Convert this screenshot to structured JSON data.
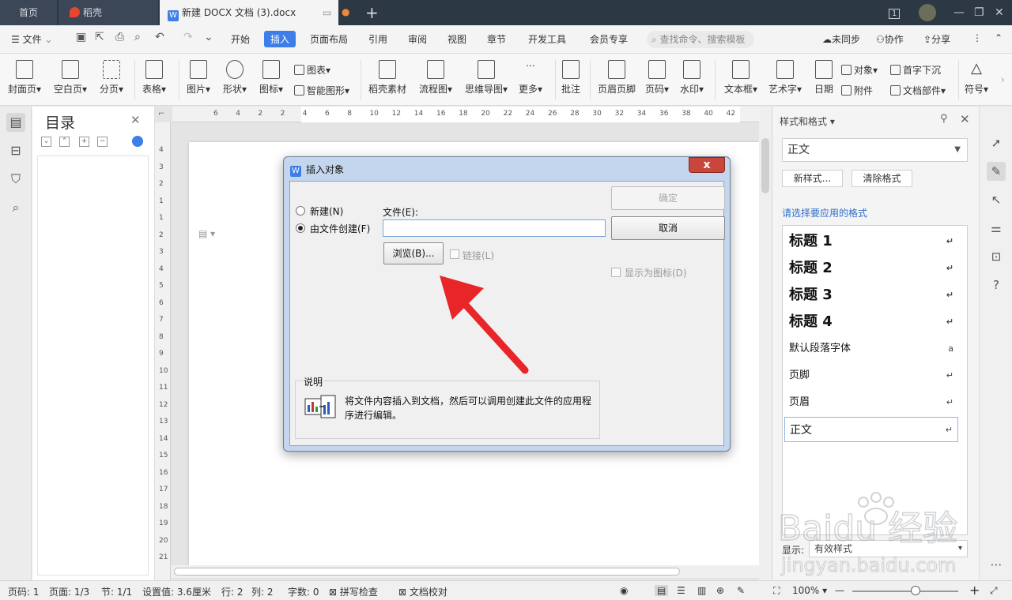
{
  "titlebar": {
    "tabs": [
      {
        "label": "首页"
      },
      {
        "label": "稻壳"
      },
      {
        "label": "新建 DOCX 文档 (3).docx"
      }
    ],
    "new_tab": "+",
    "page_badge": "1"
  },
  "menubar": {
    "file": "文件",
    "items": [
      "开始",
      "插入",
      "页面布局",
      "引用",
      "审阅",
      "视图",
      "章节",
      "开发工具",
      "会员专享"
    ],
    "search_placeholder": "查找命令、搜索模板",
    "sync": "未同步",
    "collab": "协作",
    "share": "分享"
  },
  "ribbon": {
    "cover": "封面页",
    "blank": "空白页",
    "pagebreak": "分页",
    "table": "表格",
    "picture": "图片",
    "shape": "形状",
    "icon": "图标",
    "chart": "图表",
    "smartart": "智能图形",
    "daoke": "稻壳素材",
    "flowchart": "流程图",
    "mindmap": "思维导图",
    "more": "更多",
    "comment": "批注",
    "header_footer": "页眉页脚",
    "page_number": "页码",
    "watermark": "水印",
    "textbox": "文本框",
    "wordart": "艺术字",
    "date": "日期",
    "object": "对象",
    "attachment": "附件",
    "dropcap": "首字下沉",
    "docpart": "文档部件",
    "symbol": "符号"
  },
  "toc": {
    "title": "目录"
  },
  "ruler": {
    "h_numbers": [
      "6",
      "4",
      "2",
      "2",
      "4",
      "6",
      "8",
      "10",
      "12",
      "14",
      "16",
      "18",
      "20",
      "22",
      "24",
      "26",
      "28",
      "30",
      "32",
      "34",
      "36",
      "38",
      "40",
      "42"
    ],
    "v_numbers": [
      "4",
      "3",
      "2",
      "1",
      "1",
      "2",
      "3",
      "4",
      "5",
      "6",
      "7",
      "8",
      "9",
      "10",
      "11",
      "12",
      "13",
      "14",
      "15",
      "16",
      "17",
      "18",
      "19",
      "20",
      "21"
    ]
  },
  "stylepane": {
    "title": "样式和格式",
    "current": "正文",
    "new_style": "新样式...",
    "clear_format": "清除格式",
    "prompt": "请选择要应用的格式",
    "items": [
      {
        "label": "标题  1",
        "mark": "↵"
      },
      {
        "label": "标题  2",
        "mark": "↵"
      },
      {
        "label": "标题  3",
        "mark": "↵"
      },
      {
        "label": "标题  4",
        "mark": "↵"
      },
      {
        "label": "默认段落字体",
        "mark": "a"
      },
      {
        "label": "页脚",
        "mark": "↵"
      },
      {
        "label": "页眉",
        "mark": "↵"
      },
      {
        "label": "正文",
        "mark": "↵"
      }
    ],
    "show_label": "显示:",
    "show_value": "有效样式"
  },
  "dialog": {
    "title": "插入对象",
    "close": "x",
    "radio_new": "新建(N)",
    "radio_from_file": "由文件创建(F)",
    "file_label": "文件(E):",
    "file_value": "",
    "browse": "浏览(B)...",
    "link": "链接(L)",
    "ok": "确定",
    "cancel": "取消",
    "show_as_icon": "显示为图标(D)",
    "desc_label": "说明",
    "desc_text": "将文件内容插入到文档，然后可以调用创建此文件的应用程序进行编辑。"
  },
  "statusbar": {
    "page": "页码: 1",
    "pages": "页面: 1/3",
    "section": "节: 1/1",
    "setting": "设置值: 3.6厘米",
    "row": "行: 2",
    "col": "列: 2",
    "words": "字数: 0",
    "spell": "拼写检查",
    "proof": "文档校对",
    "zoom": "100%",
    "zoom_level": 0.6
  },
  "watermark": {
    "brand": "Baidu 经验",
    "url": "jingyan.baidu.com"
  },
  "colors": {
    "accent": "#3d7ee8",
    "titlebar": "#2d3845",
    "arrow": "#e8262a"
  }
}
